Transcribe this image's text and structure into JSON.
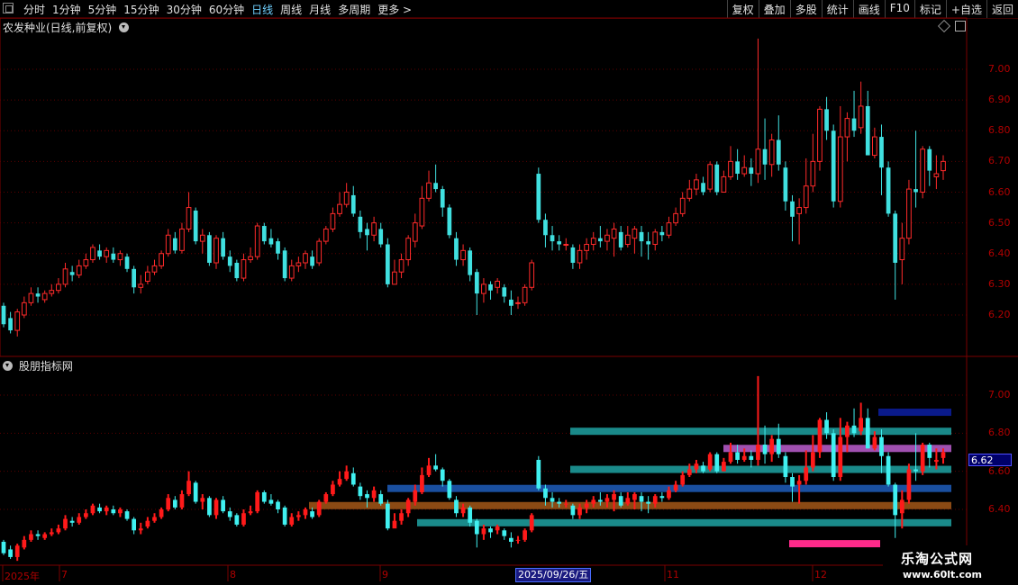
{
  "toolbar": {
    "periods": [
      "分时",
      "1分钟",
      "5分钟",
      "15分钟",
      "30分钟",
      "60分钟",
      "日线",
      "周线",
      "月线",
      "多周期",
      "更多 >"
    ],
    "active_period": "日线",
    "tools": [
      "复权",
      "叠加",
      "多股",
      "统计",
      "画线",
      "F10",
      "标记",
      "+自选",
      "返回"
    ]
  },
  "main_panel": {
    "title": "农发种业(日线,前复权)",
    "y_ticks": [
      "7.00",
      "6.90",
      "6.80",
      "6.70",
      "6.60",
      "6.50",
      "6.40",
      "6.30",
      "6.20"
    ]
  },
  "indicator_panel": {
    "title": "股朋指标网",
    "y_ticks": [
      "7.00",
      "6.80",
      "6.60",
      "6.40"
    ],
    "current_price": "6.62"
  },
  "date_axis": {
    "labels": [
      "2025年",
      "7",
      "8",
      "9",
      "11",
      "12"
    ],
    "cursor_date": "2025/09/26/五"
  },
  "watermark": {
    "line1": "乐淘公式网",
    "line2": "www.60lt.com"
  },
  "colors": {
    "up": "#ff2a2a",
    "down": "#40e0e0",
    "axis": "#b00000"
  },
  "chart_data": {
    "type": "candlestick",
    "ylim": [
      6.12,
      7.12
    ],
    "candles": [
      [
        6.23,
        6.17,
        6.24,
        6.16
      ],
      [
        6.19,
        6.15,
        6.21,
        6.14
      ],
      [
        6.15,
        6.21,
        6.22,
        6.13
      ],
      [
        6.2,
        6.24,
        6.26,
        6.19
      ],
      [
        6.24,
        6.27,
        6.29,
        6.23
      ],
      [
        6.27,
        6.26,
        6.29,
        6.24
      ],
      [
        6.25,
        6.27,
        6.28,
        6.24
      ],
      [
        6.27,
        6.28,
        6.3,
        6.26
      ],
      [
        6.28,
        6.3,
        6.32,
        6.27
      ],
      [
        6.3,
        6.35,
        6.37,
        6.29
      ],
      [
        6.34,
        6.33,
        6.36,
        6.31
      ],
      [
        6.33,
        6.36,
        6.38,
        6.32
      ],
      [
        6.36,
        6.38,
        6.4,
        6.35
      ],
      [
        6.38,
        6.42,
        6.43,
        6.37
      ],
      [
        6.41,
        6.39,
        6.43,
        6.38
      ],
      [
        6.39,
        6.41,
        6.42,
        6.37
      ],
      [
        6.4,
        6.38,
        6.42,
        6.37
      ],
      [
        6.38,
        6.4,
        6.41,
        6.36
      ],
      [
        6.39,
        6.35,
        6.4,
        6.34
      ],
      [
        6.35,
        6.29,
        6.36,
        6.27
      ],
      [
        6.29,
        6.3,
        6.33,
        6.27
      ],
      [
        6.31,
        6.34,
        6.36,
        6.3
      ],
      [
        6.34,
        6.36,
        6.38,
        6.33
      ],
      [
        6.36,
        6.4,
        6.41,
        6.35
      ],
      [
        6.4,
        6.46,
        6.48,
        6.39
      ],
      [
        6.45,
        6.41,
        6.47,
        6.4
      ],
      [
        6.41,
        6.48,
        6.5,
        6.4
      ],
      [
        6.48,
        6.55,
        6.6,
        6.47
      ],
      [
        6.54,
        6.44,
        6.55,
        6.43
      ],
      [
        6.44,
        6.46,
        6.48,
        6.4
      ],
      [
        6.46,
        6.37,
        6.47,
        6.36
      ],
      [
        6.37,
        6.45,
        6.46,
        6.35
      ],
      [
        6.45,
        6.39,
        6.47,
        6.38
      ],
      [
        6.39,
        6.36,
        6.41,
        6.34
      ],
      [
        6.37,
        6.32,
        6.38,
        6.31
      ],
      [
        6.32,
        6.38,
        6.4,
        6.31
      ],
      [
        6.38,
        6.39,
        6.42,
        6.37
      ],
      [
        6.39,
        6.49,
        6.5,
        6.38
      ],
      [
        6.49,
        6.44,
        6.5,
        6.43
      ],
      [
        6.45,
        6.43,
        6.48,
        6.42
      ],
      [
        6.44,
        6.4,
        6.45,
        6.38
      ],
      [
        6.41,
        6.32,
        6.42,
        6.31
      ],
      [
        6.32,
        6.36,
        6.38,
        6.31
      ],
      [
        6.36,
        6.37,
        6.39,
        6.34
      ],
      [
        6.37,
        6.4,
        6.41,
        6.35
      ],
      [
        6.39,
        6.36,
        6.41,
        6.35
      ],
      [
        6.37,
        6.44,
        6.45,
        6.36
      ],
      [
        6.44,
        6.48,
        6.49,
        6.43
      ],
      [
        6.48,
        6.53,
        6.55,
        6.47
      ],
      [
        6.53,
        6.56,
        6.6,
        6.52
      ],
      [
        6.56,
        6.6,
        6.63,
        6.55
      ],
      [
        6.59,
        6.53,
        6.62,
        6.52
      ],
      [
        6.52,
        6.47,
        6.54,
        6.45
      ],
      [
        6.48,
        6.46,
        6.5,
        6.41
      ],
      [
        6.46,
        6.5,
        6.52,
        6.44
      ],
      [
        6.48,
        6.43,
        6.5,
        6.42
      ],
      [
        6.43,
        6.3,
        6.45,
        6.29
      ],
      [
        6.3,
        6.34,
        6.38,
        6.31
      ],
      [
        6.34,
        6.38,
        6.4,
        6.32
      ],
      [
        6.38,
        6.45,
        6.46,
        6.36
      ],
      [
        6.44,
        6.5,
        6.53,
        6.42
      ],
      [
        6.49,
        6.58,
        6.62,
        6.48
      ],
      [
        6.58,
        6.63,
        6.67,
        6.57
      ],
      [
        6.63,
        6.61,
        6.69,
        6.6
      ],
      [
        6.61,
        6.55,
        6.62,
        6.52
      ],
      [
        6.55,
        6.46,
        6.56,
        6.45
      ],
      [
        6.45,
        6.38,
        6.47,
        6.36
      ],
      [
        6.38,
        6.41,
        6.43,
        6.36
      ],
      [
        6.41,
        6.33,
        6.42,
        6.31
      ],
      [
        6.34,
        6.27,
        6.35,
        6.2
      ],
      [
        6.27,
        6.3,
        6.32,
        6.24
      ],
      [
        6.3,
        6.28,
        6.31,
        6.25
      ],
      [
        6.29,
        6.31,
        6.32,
        6.27
      ],
      [
        6.29,
        6.26,
        6.3,
        6.24
      ],
      [
        6.25,
        6.23,
        6.28,
        6.2
      ],
      [
        6.24,
        6.24,
        6.26,
        6.22
      ],
      [
        6.24,
        6.29,
        6.3,
        6.23
      ],
      [
        6.29,
        6.37,
        6.38,
        6.28
      ],
      [
        6.66,
        6.51,
        6.68,
        6.5
      ],
      [
        6.51,
        6.46,
        6.53,
        6.42
      ],
      [
        6.46,
        6.44,
        6.49,
        6.41
      ],
      [
        6.44,
        6.43,
        6.46,
        6.41
      ],
      [
        6.43,
        6.43,
        6.45,
        6.41
      ],
      [
        6.42,
        6.37,
        6.43,
        6.35
      ],
      [
        6.37,
        6.41,
        6.43,
        6.35
      ],
      [
        6.41,
        6.43,
        6.45,
        6.38
      ],
      [
        6.43,
        6.45,
        6.47,
        6.41
      ],
      [
        6.45,
        6.44,
        6.49,
        6.42
      ],
      [
        6.44,
        6.46,
        6.48,
        6.41
      ],
      [
        6.45,
        6.48,
        6.5,
        6.39
      ],
      [
        6.47,
        6.42,
        6.49,
        6.41
      ],
      [
        6.43,
        6.46,
        6.49,
        6.42
      ],
      [
        6.45,
        6.48,
        6.49,
        6.4
      ],
      [
        6.47,
        6.44,
        6.49,
        6.39
      ],
      [
        6.44,
        6.43,
        6.47,
        6.38
      ],
      [
        6.43,
        6.47,
        6.48,
        6.41
      ],
      [
        6.47,
        6.46,
        6.49,
        6.44
      ],
      [
        6.46,
        6.5,
        6.52,
        6.45
      ],
      [
        6.5,
        6.53,
        6.55,
        6.49
      ],
      [
        6.53,
        6.58,
        6.6,
        6.52
      ],
      [
        6.58,
        6.61,
        6.64,
        6.57
      ],
      [
        6.61,
        6.64,
        6.66,
        6.59
      ],
      [
        6.63,
        6.6,
        6.65,
        6.59
      ],
      [
        6.61,
        6.69,
        6.7,
        6.6
      ],
      [
        6.69,
        6.6,
        6.7,
        6.59
      ],
      [
        6.6,
        6.65,
        6.67,
        6.6
      ],
      [
        6.65,
        6.7,
        6.75,
        6.64
      ],
      [
        6.7,
        6.66,
        6.74,
        6.64
      ],
      [
        6.66,
        6.68,
        6.72,
        6.65
      ],
      [
        6.68,
        6.66,
        6.71,
        6.62
      ],
      [
        6.66,
        6.74,
        7.1,
        6.63
      ],
      [
        6.74,
        6.69,
        6.84,
        6.64
      ],
      [
        6.69,
        6.77,
        6.79,
        6.65
      ],
      [
        6.77,
        6.69,
        6.85,
        6.67
      ],
      [
        6.68,
        6.57,
        6.7,
        6.54
      ],
      [
        6.57,
        6.52,
        6.59,
        6.44
      ],
      [
        6.53,
        6.55,
        6.58,
        6.43
      ],
      [
        6.55,
        6.62,
        6.71,
        6.53
      ],
      [
        6.62,
        6.7,
        6.79,
        6.6
      ],
      [
        6.7,
        6.87,
        6.88,
        6.67
      ],
      [
        6.87,
        6.8,
        6.91,
        6.77
      ],
      [
        6.8,
        6.57,
        6.82,
        6.55
      ],
      [
        6.57,
        6.78,
        6.88,
        6.55
      ],
      [
        6.78,
        6.84,
        6.86,
        6.7
      ],
      [
        6.84,
        6.8,
        6.93,
        6.78
      ],
      [
        6.81,
        6.88,
        6.96,
        6.79
      ],
      [
        6.88,
        6.72,
        6.93,
        6.72
      ],
      [
        6.72,
        6.78,
        6.81,
        6.71
      ],
      [
        6.78,
        6.68,
        6.82,
        6.59
      ],
      [
        6.68,
        6.53,
        6.7,
        6.52
      ],
      [
        6.53,
        6.37,
        6.54,
        6.25
      ],
      [
        6.38,
        6.45,
        6.5,
        6.3
      ],
      [
        6.45,
        6.61,
        6.64,
        6.43
      ],
      [
        6.61,
        6.6,
        6.8,
        6.55
      ],
      [
        6.6,
        6.74,
        6.75,
        6.58
      ],
      [
        6.74,
        6.67,
        6.75,
        6.62
      ],
      [
        6.65,
        6.66,
        6.72,
        6.61
      ],
      [
        6.67,
        6.7,
        6.72,
        6.64
      ]
    ],
    "bands": [
      {
        "level": 6.91,
        "color": "#0a1a8a"
      },
      {
        "level": 6.81,
        "color": "#1a8a8a"
      },
      {
        "level": 6.72,
        "color": "#a050b0"
      },
      {
        "level": 6.61,
        "color": "#1a8a8a"
      },
      {
        "level": 6.51,
        "color": "#1a4f9f"
      },
      {
        "level": 6.42,
        "color": "#8b4a14"
      },
      {
        "level": 6.33,
        "color": "#1a8a8a"
      },
      {
        "level": 6.22,
        "color": "#ff2a8a"
      }
    ]
  }
}
